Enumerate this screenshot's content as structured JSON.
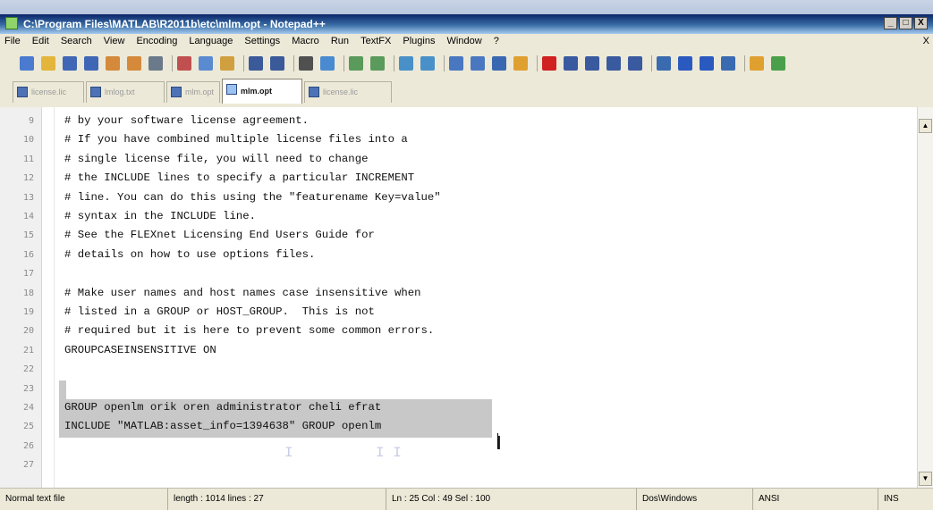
{
  "window": {
    "title": "C:\\Program Files\\MATLAB\\R2011b\\etc\\mlm.opt - Notepad++",
    "controls": [
      "_",
      "□",
      "X"
    ]
  },
  "menubar": {
    "items": [
      "File",
      "Edit",
      "Search",
      "View",
      "Encoding",
      "Language",
      "Settings",
      "Macro",
      "Run",
      "TextFX",
      "Plugins",
      "Window",
      "?"
    ],
    "close_doc": "X"
  },
  "toolbar": {
    "buttons": [
      {
        "icon": "new-file-icon",
        "color": "#4a7bd0"
      },
      {
        "icon": "open-folder-icon",
        "color": "#e3b53a"
      },
      {
        "icon": "save-icon",
        "color": "#3f67b5"
      },
      {
        "icon": "save-all-icon",
        "color": "#3f67b5"
      },
      {
        "icon": "close-icon",
        "color": "#d48a3a"
      },
      {
        "icon": "close-all-icon",
        "color": "#d48a3a"
      },
      {
        "icon": "print-icon",
        "color": "#6b7a8a"
      },
      {
        "icon": "cut-icon",
        "color": "#c05050"
      },
      {
        "icon": "copy-icon",
        "color": "#5a8ad0"
      },
      {
        "icon": "paste-icon",
        "color": "#d0a040"
      },
      {
        "icon": "undo-icon",
        "color": "#3a5a9a"
      },
      {
        "icon": "redo-icon",
        "color": "#3a5a9a"
      },
      {
        "icon": "find-icon",
        "color": "#505050"
      },
      {
        "icon": "replace-icon",
        "color": "#4a8ad0"
      },
      {
        "icon": "zoom-in-icon",
        "color": "#5a9a5a"
      },
      {
        "icon": "zoom-out-icon",
        "color": "#5a9a5a"
      },
      {
        "icon": "sync-vertical-icon",
        "color": "#4a90c8"
      },
      {
        "icon": "sync-horizontal-icon",
        "color": "#4a90c8"
      },
      {
        "icon": "word-wrap-icon",
        "color": "#4a78c0"
      },
      {
        "icon": "show-all-chars-icon",
        "color": "#4a78c0"
      },
      {
        "icon": "indent-guide-icon",
        "color": "#3a68b0"
      },
      {
        "icon": "doc-map-icon",
        "color": "#e0a030"
      },
      {
        "icon": "record-macro-icon",
        "color": "#d02020"
      },
      {
        "icon": "stop-macro-icon",
        "color": "#3a5aa0"
      },
      {
        "icon": "play-macro-icon",
        "color": "#3a5aa0"
      },
      {
        "icon": "run-macro-icon",
        "color": "#3a5aa0"
      },
      {
        "icon": "save-macro-icon",
        "color": "#3a5aa0"
      },
      {
        "icon": "function-list-icon",
        "color": "#3a6ab0"
      },
      {
        "icon": "move-up-icon",
        "color": "#2a5ac0"
      },
      {
        "icon": "move-down-icon",
        "color": "#2a5ac0"
      },
      {
        "icon": "sort-icon",
        "color": "#3a6ab0"
      },
      {
        "icon": "trim-icon",
        "color": "#e0a030"
      },
      {
        "icon": "spell-check-icon",
        "color": "#4aa04a"
      }
    ]
  },
  "tabs": [
    {
      "label": "license.lic",
      "active": false
    },
    {
      "label": "lmlog.txt",
      "active": false
    },
    {
      "label": "mlm.opt",
      "active": false
    },
    {
      "label": "mlm.opt",
      "active": true
    },
    {
      "label": "license.lic",
      "active": false
    }
  ],
  "editor": {
    "lines": [
      {
        "num": "9",
        "text": "# by your software license agreement."
      },
      {
        "num": "10",
        "text": "# If you have combined multiple license files into a"
      },
      {
        "num": "11",
        "text": "# single license file, you will need to change"
      },
      {
        "num": "12",
        "text": "# the INCLUDE lines to specify a particular INCREMENT"
      },
      {
        "num": "13",
        "text": "# line. You can do this using the \"featurename Key=value\""
      },
      {
        "num": "14",
        "text": "# syntax in the INCLUDE line."
      },
      {
        "num": "15",
        "text": "# See the FLEXnet Licensing End Users Guide for"
      },
      {
        "num": "16",
        "text": "# details on how to use options files."
      },
      {
        "num": "17",
        "text": ""
      },
      {
        "num": "18",
        "text": "# Make user names and host names case insensitive when"
      },
      {
        "num": "19",
        "text": "# listed in a GROUP or HOST_GROUP.  This is not"
      },
      {
        "num": "20",
        "text": "# required but it is here to prevent some common errors."
      },
      {
        "num": "21",
        "text": "GROUPCASEINSENSITIVE ON"
      },
      {
        "num": "22",
        "text": ""
      },
      {
        "num": "23",
        "text": ""
      },
      {
        "num": "24",
        "text": "GROUP openlm orik oren administrator cheli efrat"
      },
      {
        "num": "25",
        "text": "INCLUDE \"MATLAB:asset_info=1394638\" GROUP openlm"
      },
      {
        "num": "26",
        "text": ""
      },
      {
        "num": "27",
        "text": ""
      }
    ],
    "scroll_up": "▲",
    "scroll_down": "▼"
  },
  "statusbar": {
    "filetype": "Normal text file",
    "length_lines": "length : 1014   lines : 27",
    "position": "Ln : 25   Col : 49   Sel : 100",
    "eol": "Dos\\Windows",
    "encoding": "ANSI",
    "mode": "INS"
  }
}
